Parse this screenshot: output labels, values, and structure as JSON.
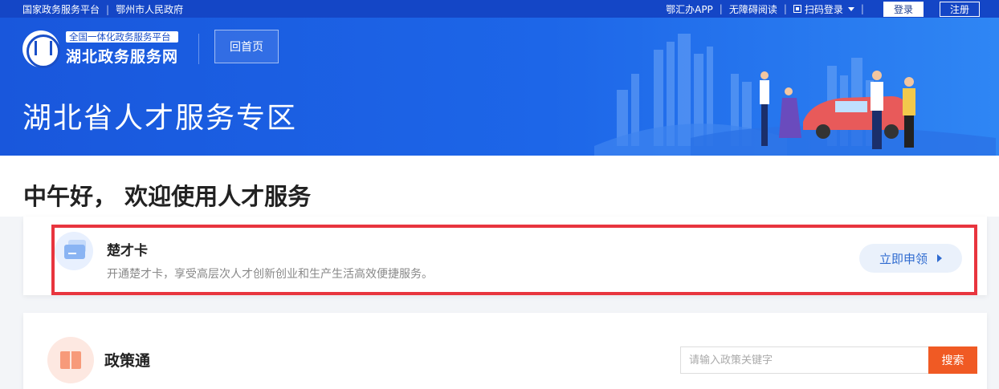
{
  "topbar": {
    "link_national": "国家政务服务平台",
    "link_ezhou": "鄂州市人民政府",
    "link_app": "鄂汇办APP",
    "link_accessible": "无障碍阅读",
    "scan_login": "扫码登录",
    "login": "登录",
    "register": "注册",
    "separator": "|"
  },
  "header": {
    "logo_tag": "全国一体化政务服务平台",
    "logo_name": "湖北政务服务网",
    "home_button": "回首页",
    "title": "湖北省人才服务专区"
  },
  "greeting": "中午好， 欢迎使用人才服务",
  "talent_card": {
    "title": "楚才卡",
    "description": "开通楚才卡，享受高层次人才创新创业和生产生活高效便捷服务。",
    "apply_button": "立即申领"
  },
  "policy": {
    "title": "政策通",
    "search_placeholder": "请输入政策关键字",
    "search_button": "搜索"
  },
  "colors": {
    "banner": "#1d66e8",
    "highlight": "#e8353e",
    "search_button": "#f05a24"
  }
}
